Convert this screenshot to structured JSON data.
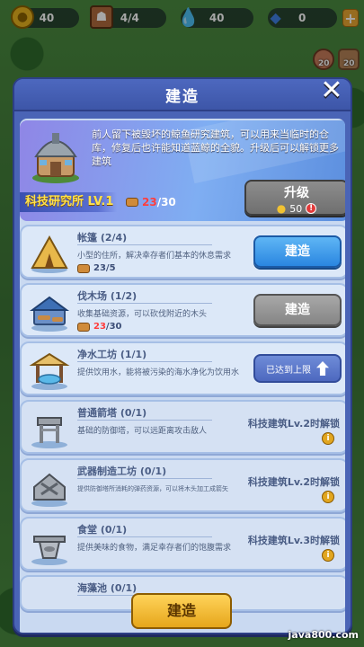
{
  "topbar": {
    "gold": "40",
    "population": "4/4",
    "water": "40",
    "gems": "0",
    "plus": "+"
  },
  "side": {
    "left_count": "20",
    "right_count": "20"
  },
  "modal": {
    "title": "建造",
    "close": "✕",
    "feature": {
      "description": "前人留下被毁坏的鲸鱼研究建筑，可以用来当临时的仓库，修复后也许能知道蓝鲸的全貌。升级后可以解锁更多建筑",
      "name": "科技研究所 LV.1",
      "cost_have": "23",
      "cost_need": "/30",
      "upgrade_label": "升级",
      "upgrade_cost": "50",
      "alert": "!"
    },
    "buildings": [
      {
        "name": "帐篷 (2/4)",
        "desc": "小型的住所，解决幸存者们基本的休息需求",
        "cost_have": "23",
        "cost_need": "/5",
        "cost_ok": true,
        "action": "建造",
        "state": "build"
      },
      {
        "name": "伐木场 (1/2)",
        "desc": "收集基础资源，可以砍伐附近的木头",
        "cost_have": "23",
        "cost_need": "/30",
        "cost_ok": false,
        "action": "建造",
        "state": "disabled"
      },
      {
        "name": "净水工坊 (1/1)",
        "desc": "提供饮用水，能将被污染的海水净化为饮用水",
        "action": "已达到上限",
        "state": "max"
      },
      {
        "name": "普通箭塔 (0/1)",
        "desc": "基础的防御塔，可以远距离攻击敌人",
        "action": "科技建筑Lv.2时解锁",
        "state": "locked"
      },
      {
        "name": "武器制造工坊 (0/1)",
        "desc": "提供防御塔所消耗的弹药资源，可以将木头加工成箭矢",
        "action": "科技建筑Lv.2时解锁",
        "state": "locked"
      },
      {
        "name": "食堂 (0/1)",
        "desc": "提供美味的食物，满足幸存者们的饱腹需求",
        "action": "科技建筑Lv.3时解锁",
        "state": "locked"
      },
      {
        "name": "海藻池 (0/1)",
        "desc": "",
        "action": "",
        "state": "partial"
      }
    ]
  },
  "bottom": {
    "build_label": "建造"
  },
  "watermark": "java800.com",
  "colors": {
    "accent": "#4a64b6",
    "build_blue": "#2a86e0",
    "gold": "#ffe14a",
    "red": "#ff3d3d"
  }
}
